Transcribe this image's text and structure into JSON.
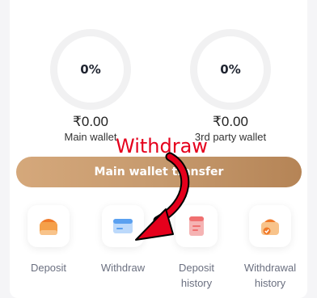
{
  "wallets": {
    "main": {
      "percent": "0%",
      "amount": "₹0.00",
      "label": "Main wallet"
    },
    "third_party": {
      "percent": "0%",
      "amount": "₹0.00",
      "label": "3rd party wallet"
    }
  },
  "transfer_button": {
    "label": "Main wallet transfer"
  },
  "actions": [
    {
      "label": "Deposit",
      "icon": "wallet-icon"
    },
    {
      "label": "Withdraw",
      "icon": "card-icon"
    },
    {
      "label": "Deposit history",
      "icon": "deposit-history-icon"
    },
    {
      "label": "Withdrawal history",
      "icon": "withdrawal-history-icon"
    }
  ],
  "annotation": {
    "text": "Withdraw",
    "color": "#e5001c"
  },
  "colors": {
    "accent": "#c69a6e",
    "deposit_icon": "#f5a04a",
    "withdraw_icon": "#5aa0f0",
    "history_icon": "#f07070"
  }
}
